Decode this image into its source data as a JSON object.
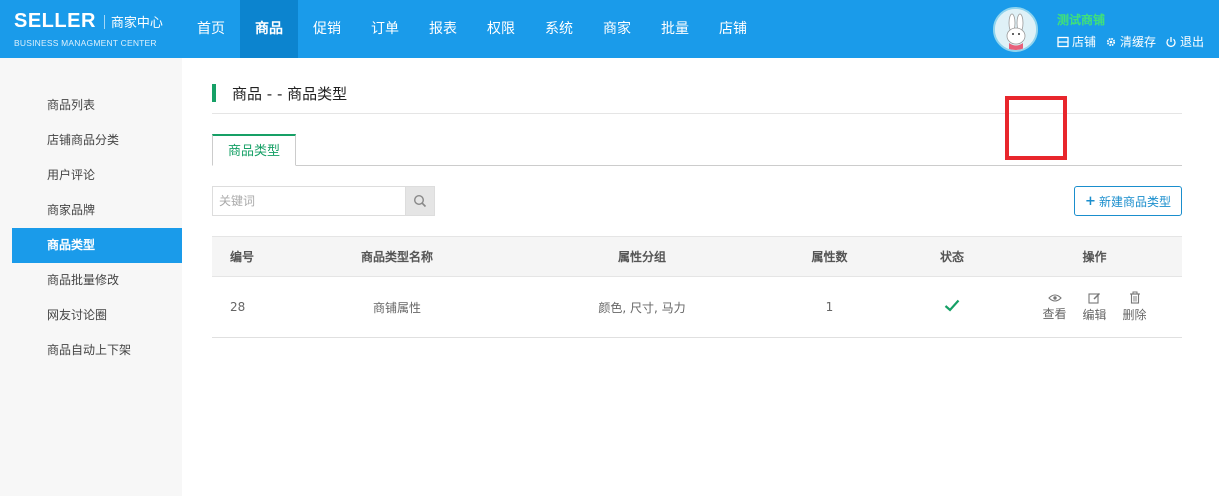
{
  "header": {
    "logo_title": "SELLER",
    "logo_subtitle": "商家中心",
    "logo_english": "BUSINESS MANAGMENT CENTER",
    "nav": [
      "首页",
      "商品",
      "促销",
      "订单",
      "报表",
      "权限",
      "系统",
      "商家",
      "批量",
      "店铺"
    ],
    "active_nav": "商品",
    "shop_name": "测试商铺",
    "actions": {
      "store": "店铺",
      "clear_cache": "清缓存",
      "logout": "退出"
    },
    "colors": {
      "bar": "#1a9bea",
      "active": "#0c84cf",
      "shop_name": "#40e07a"
    }
  },
  "sidebar": {
    "items": [
      "商品列表",
      "店铺商品分类",
      "用户评论",
      "商家品牌",
      "商品类型",
      "商品批量修改",
      "网友讨论圈",
      "商品自动上下架"
    ],
    "active": "商品类型"
  },
  "main": {
    "breadcrumb": "商品 - - 商品类型",
    "tab": "商品类型",
    "search_placeholder": "关键词",
    "search_value": "",
    "add_button": "新建商品类型",
    "table": {
      "headers": [
        "编号",
        "商品类型名称",
        "属性分组",
        "属性数",
        "状态",
        "操作"
      ],
      "rows": [
        {
          "id": "28",
          "name": "商铺属性",
          "groups": "颜色, 尺寸, 马力",
          "attr_count": "1",
          "status": "check-icon",
          "ops": [
            "查看",
            "编辑",
            "删除"
          ]
        }
      ]
    },
    "colors": {
      "accent_green": "#16a066",
      "highlight_red": "#e8262c"
    }
  }
}
